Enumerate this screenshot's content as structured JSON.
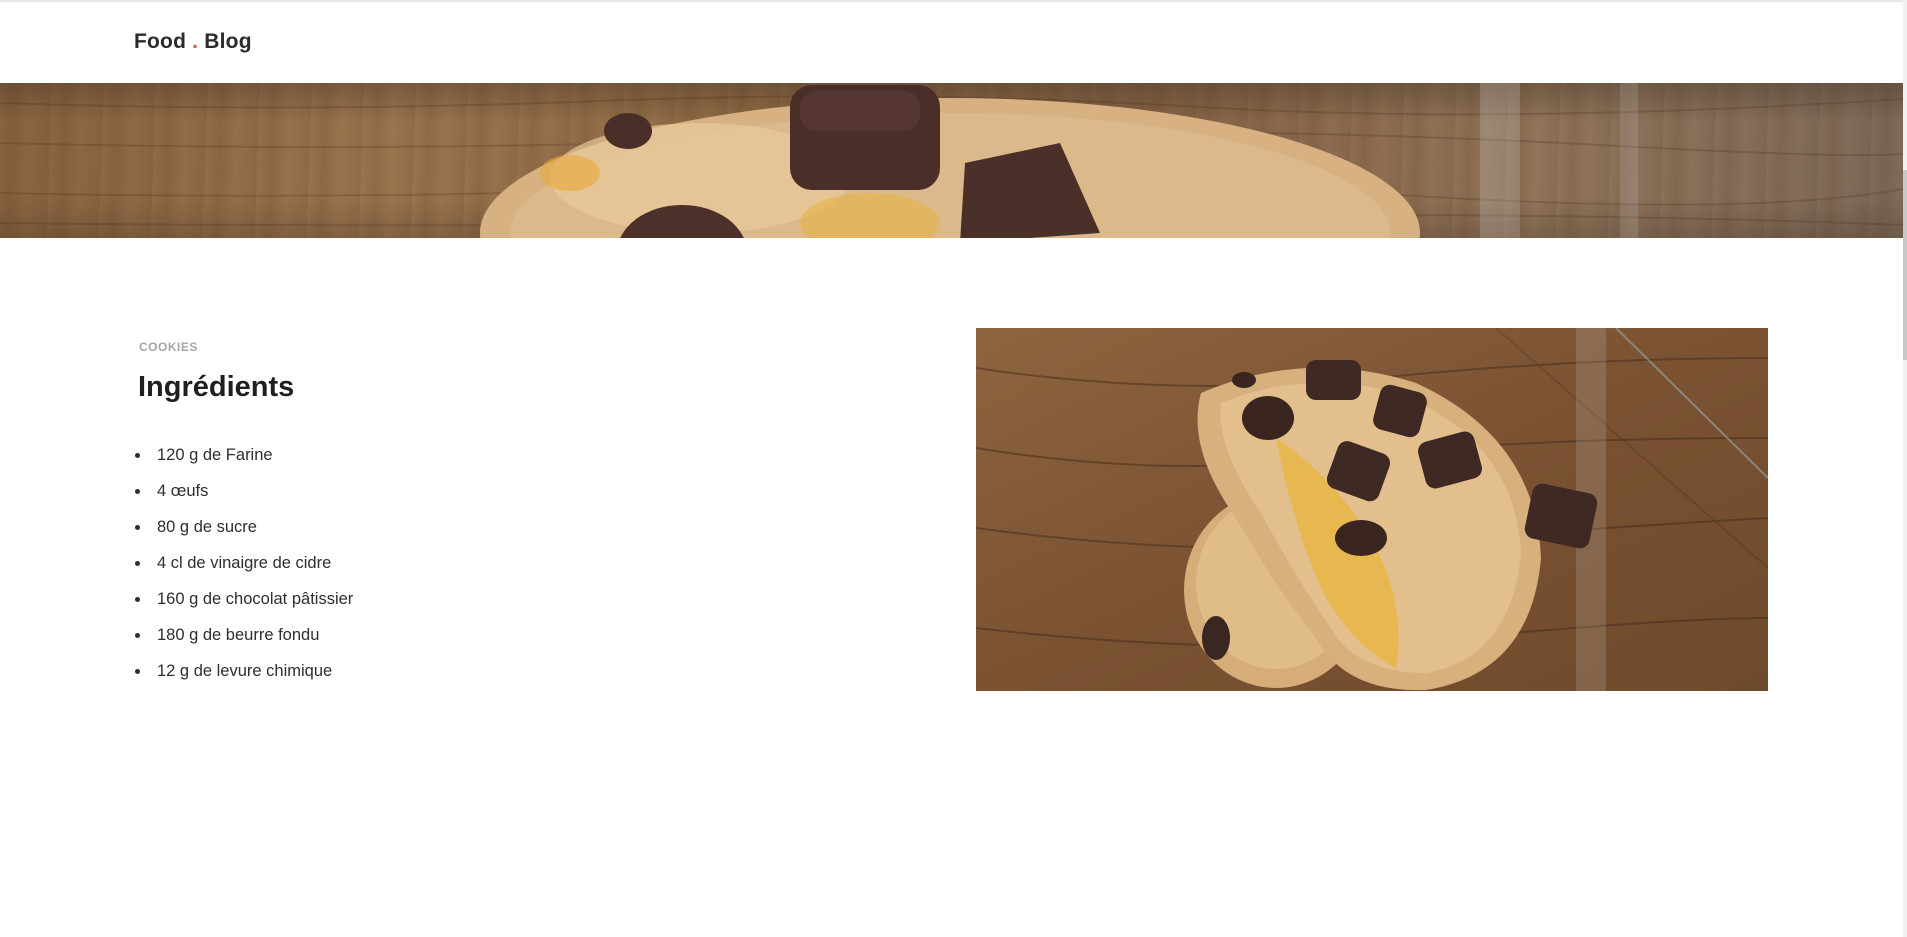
{
  "header": {
    "brand_left": "Food",
    "brand_dot": ".",
    "brand_right": "Blog"
  },
  "hero": {
    "image": "chocolate-chip-cookie-banner"
  },
  "article": {
    "category": "COOKIES",
    "title": "Ingrédients",
    "ingredients": [
      "120 g de Farine",
      "4 œufs",
      "80 g de sucre",
      "4 cl de vinaigre de cidre",
      "160 g de chocolat pâtissier",
      "180 g de beurre fondu",
      "12 g de levure chimique"
    ],
    "photo": "broken-chocolate-chip-cookies-on-wooden-table"
  },
  "colors": {
    "brand_dot": "#e4572e",
    "category": "#a6a6a6",
    "title": "#1f1f1f",
    "text": "#2e2e2e"
  }
}
